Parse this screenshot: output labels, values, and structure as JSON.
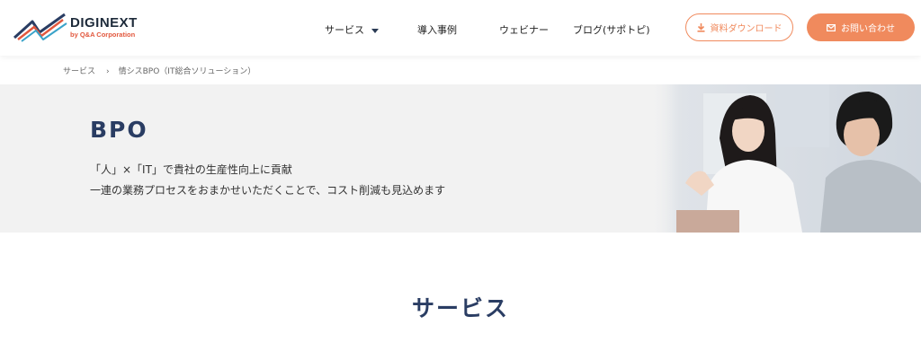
{
  "brand": {
    "name": "DIGINEXT",
    "sub": "by Q&A Corporation",
    "colors": {
      "navy": "#2a3d63",
      "accent": "#f08a5d",
      "logo_orange": "#e2583e"
    }
  },
  "nav": {
    "items": [
      {
        "label": "サービス",
        "icon": "chevron-down-icon"
      },
      {
        "label": "導入事例"
      },
      {
        "label": "ウェビナー"
      },
      {
        "label": "ブログ(サポトピ)"
      }
    ]
  },
  "buttons": {
    "download": {
      "label": "資料ダウンロード",
      "icon": "download-icon"
    },
    "contact": {
      "label": "お問い合わせ",
      "icon": "mail-icon"
    }
  },
  "breadcrumb": {
    "items": [
      "サービス",
      "情シスBPO（IT総合ソリューション）"
    ],
    "separator": "›"
  },
  "hero": {
    "title": "BPO",
    "line1": "「人」×「IT」で貴社の生産性向上に貢献",
    "line2": "一連の業務プロセスをおまかせいただくことで、コスト削減も見込めます"
  },
  "section": {
    "title": "サービス"
  }
}
